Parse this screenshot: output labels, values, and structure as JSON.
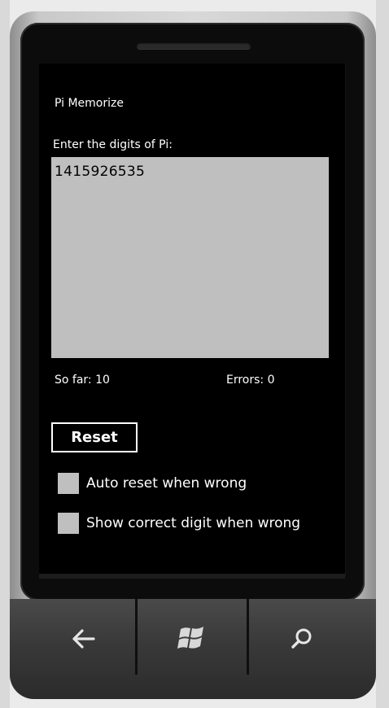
{
  "app": {
    "title": "Pi Memorize"
  },
  "entry": {
    "prompt": "Enter the digits of Pi:",
    "value": "1415926535"
  },
  "stats": {
    "so_far": "So far: 10",
    "errors": "Errors: 0"
  },
  "actions": {
    "reset_label": "Reset"
  },
  "options": [
    {
      "label": "Auto reset when wrong",
      "checked": false
    },
    {
      "label": "Show correct digit when wrong",
      "checked": false
    }
  ],
  "hardware_buttons": [
    {
      "name": "back",
      "icon": "back-arrow-icon"
    },
    {
      "name": "start",
      "icon": "windows-logo-icon"
    },
    {
      "name": "search",
      "icon": "search-icon"
    }
  ],
  "colors": {
    "screen_background": "#000000",
    "text": "#ffffff",
    "input_background": "#bfbfbf",
    "checkbox_fill": "#bfbfbf"
  }
}
